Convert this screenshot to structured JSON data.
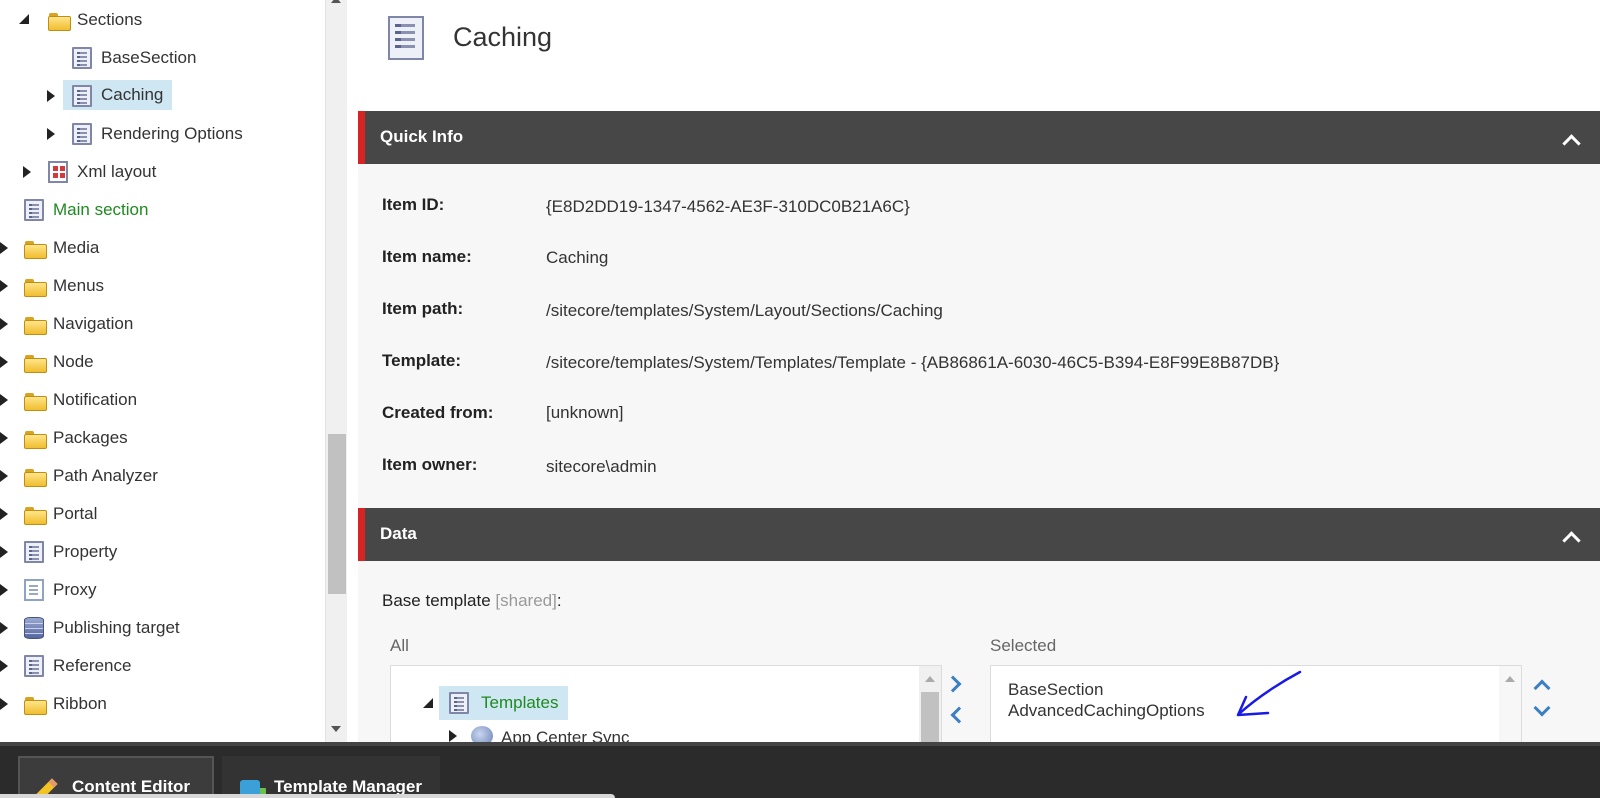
{
  "tree": {
    "items": [
      {
        "label": "Sections"
      },
      {
        "label": "BaseSection"
      },
      {
        "label": "Caching"
      },
      {
        "label": "Rendering Options"
      },
      {
        "label": "Xml layout"
      },
      {
        "label": "Main section"
      },
      {
        "label": "Media"
      },
      {
        "label": "Menus"
      },
      {
        "label": "Navigation"
      },
      {
        "label": "Node"
      },
      {
        "label": "Notification"
      },
      {
        "label": "Packages"
      },
      {
        "label": "Path Analyzer"
      },
      {
        "label": "Portal"
      },
      {
        "label": "Property"
      },
      {
        "label": "Proxy"
      },
      {
        "label": "Publishing target"
      },
      {
        "label": "Reference"
      },
      {
        "label": "Ribbon"
      }
    ]
  },
  "header": {
    "title": "Caching"
  },
  "quick_info": {
    "title": "Quick Info",
    "rows": [
      {
        "key": "Item ID:",
        "value": "{E8D2DD19-1347-4562-AE3F-310DC0B21A6C}"
      },
      {
        "key": "Item name:",
        "value": "Caching"
      },
      {
        "key": "Item path:",
        "value": "/sitecore/templates/System/Layout/Sections/Caching"
      },
      {
        "key": "Template:",
        "value": "/sitecore/templates/System/Templates/Template - {AB86861A-6030-46C5-B394-E8F99E8B87DB}"
      },
      {
        "key": "Created from:",
        "value": "[unknown]"
      },
      {
        "key": "Item owner:",
        "value": "sitecore\\admin"
      }
    ]
  },
  "data_section": {
    "title": "Data",
    "base_template_label": "Base template",
    "shared_label": "[shared]",
    "colon": ":",
    "all_label": "All",
    "selected_label": "Selected",
    "all_tree": {
      "root": "Templates",
      "child": "App Center Sync"
    },
    "selected_items": [
      "BaseSection",
      "AdvancedCachingOptions"
    ]
  },
  "taskbar": {
    "tabs": [
      {
        "label": "Content Editor",
        "icon": "pencil-icon"
      },
      {
        "label": "Template Manager",
        "icon": "puzzle-icon"
      }
    ]
  },
  "colors": {
    "accent_red": "#d72323",
    "bar_dark": "#474747",
    "link_green": "#1f8a20",
    "selection_blue": "#cfe7f3",
    "annotation_blue": "#1a1ae6"
  }
}
